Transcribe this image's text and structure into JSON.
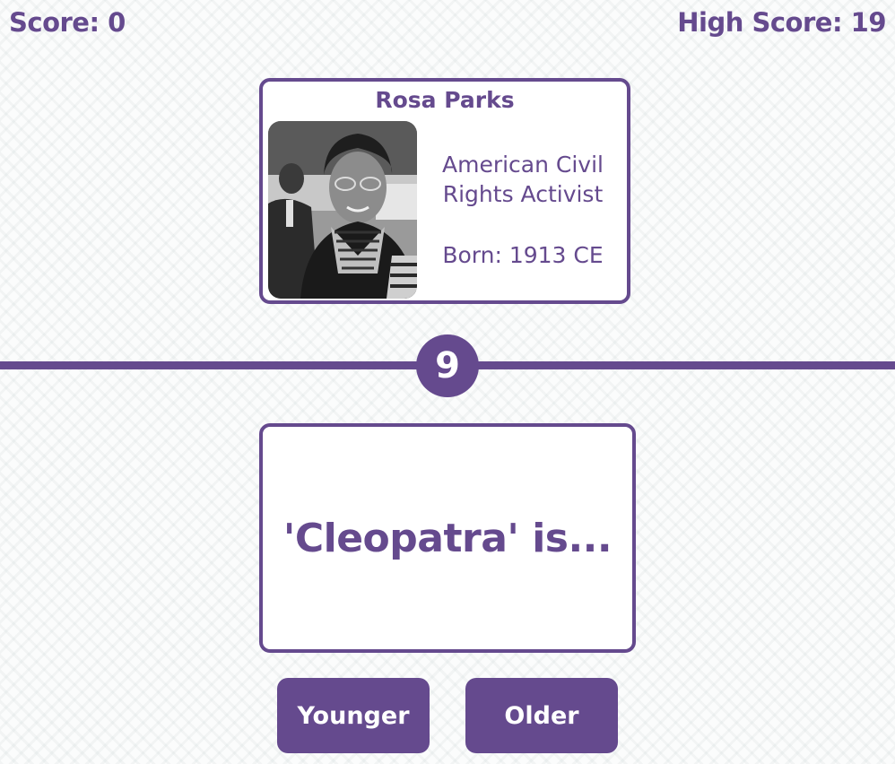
{
  "header": {
    "score_label": "Score: 0",
    "high_score_label": "High Score: 19"
  },
  "current_card": {
    "name": "Rosa Parks",
    "description": "American Civil Rights Activist",
    "born": "Born: 1913 CE",
    "photo_icon": "portrait-photo"
  },
  "streak_badge": "9",
  "question_card": {
    "text": "'Cleopatra' is..."
  },
  "buttons": {
    "younger": "Younger",
    "older": "Older"
  },
  "colors": {
    "accent": "#654a8e",
    "card_background": "#ffffff",
    "page_background": "#fbfcfc"
  }
}
